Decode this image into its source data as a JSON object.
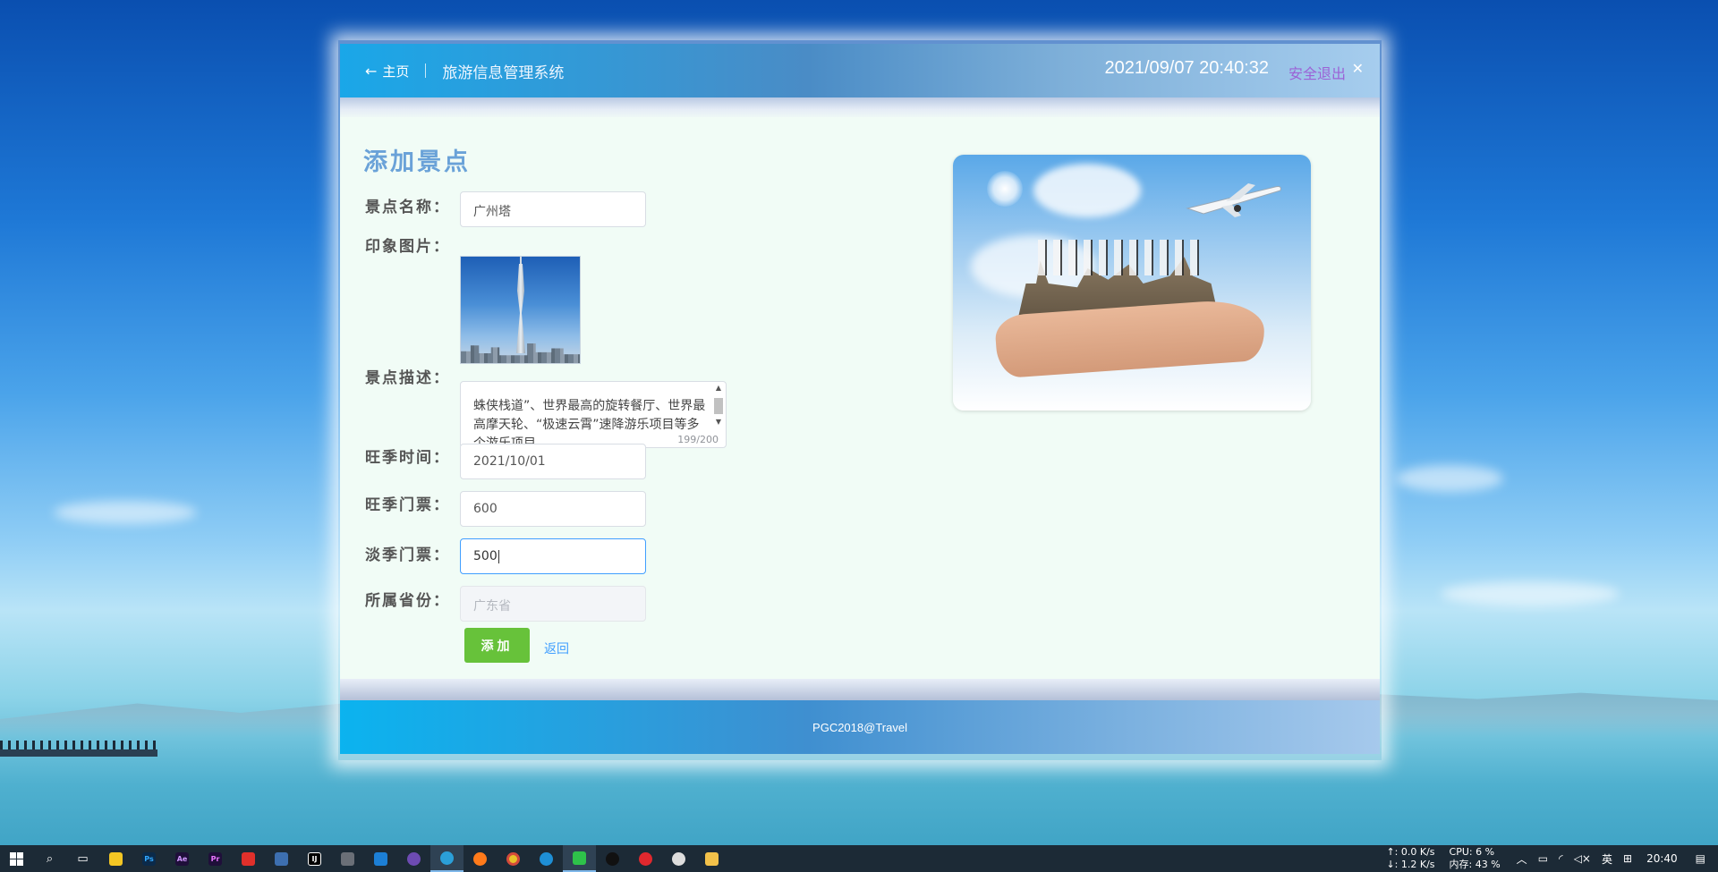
{
  "header": {
    "home_label": "主页",
    "system_title": "旅游信息管理系统",
    "datetime": "2021/09/07 20:40:32",
    "logout_label": "安全退出"
  },
  "form": {
    "page_title": "添加景点",
    "name_label": "景点名称：",
    "name_value": "广州塔",
    "image_label": "印象图片：",
    "description_label": "景点描述：",
    "description_visible_text": "蛛侠栈道”、世界最高的旋转餐厅、世界最高摩天轮、“极速云霄”速降游乐项目等多个游乐项目。",
    "description_counter": "199/200",
    "peak_time_label": "旺季时间：",
    "peak_time_value": "2021/10/01",
    "peak_ticket_label": "旺季门票：",
    "peak_ticket_value": "600",
    "off_ticket_label": "淡季门票：",
    "off_ticket_value": "500",
    "province_label": "所属省份：",
    "province_placeholder": "广东省",
    "add_button_label": "添加",
    "back_link_label": "返回"
  },
  "footer": {
    "copyright": "PGC2018@Travel"
  },
  "taskbar": {
    "net_up": "↑: 0.0 K/s",
    "net_down": "↓: 1.2 K/s",
    "cpu": "CPU: 6 %",
    "memory": "内存: 43 %",
    "ime": "英",
    "time": "20:40"
  },
  "colors": {
    "accent_title": "#6aa2d8",
    "add_button": "#67c23a",
    "link": "#409eff",
    "logout": "#9b62d6"
  }
}
